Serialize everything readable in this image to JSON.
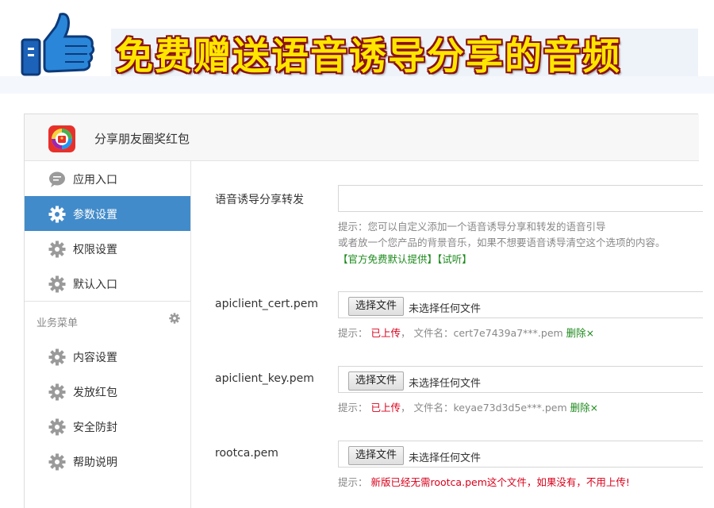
{
  "banner": {
    "title": "免费赠送语音诱导分享的音频",
    "icon": "thumbs-up-icon"
  },
  "app": {
    "title": "分享朋友圈奖红包",
    "logo_icon": "red-packet-app-icon"
  },
  "sidebar": {
    "items": [
      {
        "label": "应用入口",
        "icon": "chat-bubble-icon",
        "active": false
      },
      {
        "label": "参数设置",
        "icon": "gear-icon",
        "active": true
      },
      {
        "label": "权限设置",
        "icon": "gear-icon",
        "active": false
      },
      {
        "label": "默认入口",
        "icon": "gear-icon",
        "active": false
      }
    ],
    "section_label": "业务菜单",
    "section_items": [
      {
        "label": "内容设置",
        "icon": "gear-icon"
      },
      {
        "label": "发放红包",
        "icon": "gear-icon"
      },
      {
        "label": "安全防封",
        "icon": "gear-icon"
      },
      {
        "label": "帮助说明",
        "icon": "gear-icon"
      }
    ]
  },
  "form": {
    "voice": {
      "label": "语音诱导分享转发",
      "value": "",
      "hint_line1": "提示：您可以自定义添加一个语音诱导分享和转发的语音引导",
      "hint_line2": "或者放一个您产品的背景音乐，如果不想要语音诱导清空这个选项的内容。",
      "link_official": "【官方免费默认提供】",
      "link_listen": "【试听】"
    },
    "cert": {
      "label": "apiclient_cert.pem",
      "button": "选择文件",
      "status": "未选择任何文件",
      "hint_prefix": "提示：",
      "uploaded": "已上传",
      "filename_text": "，  文件名：cert7e7439a7***.pem",
      "delete": "删除×"
    },
    "key": {
      "label": "apiclient_key.pem",
      "button": "选择文件",
      "status": "未选择任何文件",
      "hint_prefix": "提示：",
      "uploaded": "已上传",
      "filename_text": "，  文件名：keyae73d3d5e***.pem",
      "delete": "删除×"
    },
    "rootca": {
      "label": "rootca.pem",
      "button": "选择文件",
      "status": "未选择任何文件",
      "hint_prefix": "提示：",
      "notice": "新版已经无需rootca.pem这个文件，如果没有，不用上传!"
    }
  },
  "colors": {
    "active_nav": "#428bca",
    "banner_text": "#ffe600",
    "banner_outline": "#8a1010",
    "uploaded_red": "#d9001b",
    "link_green": "#1e8a1e"
  }
}
